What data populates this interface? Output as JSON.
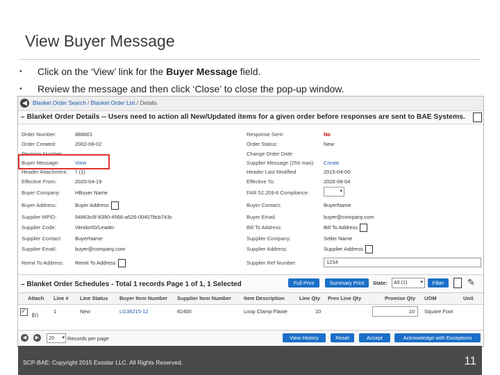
{
  "slide": {
    "title": "View Buyer Message",
    "bullets": [
      {
        "pre": "Click on the ‘View’ link for the ",
        "bold": "Buyer Message",
        "post": " field."
      },
      {
        "pre": "Review the message and then click ‘Close’ to close the pop-up window.",
        "bold": "",
        "post": ""
      }
    ],
    "footer": "SCP-BAE: Copyright 2015 Exostar LLC. All Rights Reserved.",
    "page_number": "11"
  },
  "app": {
    "breadcrumb": {
      "item1": "Blanket Order Search",
      "sep1": " / ",
      "item2": "Blanket Order List",
      "sep2": " / ",
      "current": "Details"
    },
    "header_title": "– Blanket Order Details -- Users need to action all New/Updated items for a given order before responses are sent to BAE Systems.",
    "left_fields": [
      {
        "label": "Order Number:",
        "value": "888601"
      },
      {
        "label": "Order Created:",
        "value": "2002-08-02"
      },
      {
        "label": "Revision Number:",
        "value": ""
      },
      {
        "label": "Buyer Message:",
        "value": "View"
      },
      {
        "label": "Header Attachment:",
        "value": "(1)"
      },
      {
        "label": "Effective From:",
        "value": "2020-04-19"
      },
      {
        "label": "Buyer Company:",
        "value": "HBuyer Name"
      },
      {
        "label": "Buyer Address:",
        "value": "Buyer Address"
      },
      {
        "label": "Supplier MPID:",
        "value": "54863c6f-8390-4566-a526-004078cb743c"
      },
      {
        "label": "Supplier Code:",
        "value": "VendorID/Leader"
      },
      {
        "label": "Supplier Contact:",
        "value": "BuyerName"
      },
      {
        "label": "Supplier Email:",
        "value": "buyer@company.com"
      },
      {
        "label": "Remit To Address:",
        "value": "Remit To Address"
      }
    ],
    "right_fields": [
      {
        "label": "Response Sent:",
        "value": "No"
      },
      {
        "label": "Order Status:",
        "value": "New"
      },
      {
        "label": "Change Order Date:",
        "value": ""
      },
      {
        "label": "Supplier Message (256 max):",
        "value": "Create"
      },
      {
        "label": "Header Last Modified",
        "value": "2015-04-00"
      },
      {
        "label": "Effective To:",
        "value": "2020-08-04"
      },
      {
        "label": "FAR 52.209-6 Compliance:",
        "value": ""
      },
      {
        "label": "Buyer Contact:",
        "value": "BuyerName"
      },
      {
        "label": "Buyer Email:",
        "value": "buyer@company.com"
      },
      {
        "label": "Bill To Address:",
        "value": "Bill To Address"
      },
      {
        "label": "Supplier Company:",
        "value": "Seller Name"
      },
      {
        "label": "Supplier Address:",
        "value": "Supplier Address"
      },
      {
        "label": "Supplier Ref Number:",
        "value": "1234"
      }
    ],
    "schedules": {
      "title": "– Blanket Order Schedules - Total 1 records Page 1 of 1, 1 Selected",
      "full_print": "Full Print",
      "summary_print": "Summary Print",
      "state_label": "State:",
      "state_value": "All (1)",
      "filter": "Filter",
      "columns": [
        "Attach",
        "Line #",
        "Line Status",
        "Buyer Item Number",
        "Supplier Item Number",
        "Item Description",
        "Line Qty",
        "Prev Line Qty",
        "Promise Qty",
        "UOM",
        "Unit"
      ],
      "row": {
        "attach": "(1)",
        "line": "1",
        "status": "New",
        "buyer_item": "LG38215-12",
        "supplier_item": "82400",
        "desc": "Loop Clamp Flaste",
        "qty": "10",
        "prev_qty": "",
        "promise_qty": "10",
        "uom": "Square Foot"
      }
    },
    "pager": {
      "per_page": "20",
      "per_page_label": "Records per page",
      "view_history": "View History",
      "reset": "Reset",
      "accept": "Accept",
      "ack_exceptions": "Acknowledge with Exceptions"
    },
    "colors": {
      "link": "#1b5aa8",
      "button": "#1b6fc7",
      "highlight": "#e03030",
      "no_red": "#cc0000"
    }
  }
}
